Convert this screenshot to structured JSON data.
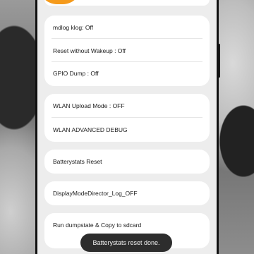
{
  "menu": {
    "group1": [
      {
        "label": "mdlog klog: Off"
      },
      {
        "label": "Reset without Wakeup : Off"
      },
      {
        "label": "GPIO Dump : Off"
      }
    ],
    "group2": [
      {
        "label": "WLAN Upload Mode : OFF"
      },
      {
        "label": "WLAN ADVANCED DEBUG"
      }
    ],
    "batterystats_reset": {
      "label": "Batterystats Reset"
    },
    "display_mode": {
      "label": "DisplayModeDirector_Log_OFF"
    },
    "dumpstate": {
      "label": "Run dumpstate & Copy to sdcard"
    }
  },
  "toast": {
    "text": "Batterystats reset done."
  },
  "colors": {
    "accent": "#f59a1b",
    "background": "#ededed",
    "card": "#ffffff",
    "toast": "#2d2d2d"
  }
}
